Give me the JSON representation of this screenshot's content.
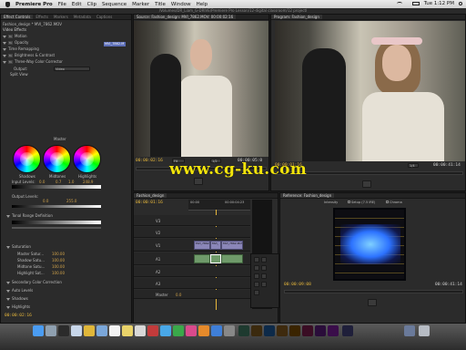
{
  "menubar": {
    "app": "Premiere Pro",
    "menus": [
      "File",
      "Edit",
      "Clip",
      "Sequence",
      "Marker",
      "Title",
      "Window",
      "Help"
    ],
    "clock": "Tue 1:12 PM"
  },
  "window_title": "/Volumes/DR_Liam_G-DRIVE/Premiere Pro Lesson/12-digital classroom/12 projectl",
  "effect_controls": {
    "tabs": [
      "Effect Controls",
      "Effects",
      "Markers",
      "Metadata",
      "Captions"
    ],
    "clip_path": "Fashion_design * MVI_7862.MOV",
    "clip_chip": "MVI_7862.M",
    "section": "Video Effects",
    "rows": [
      "Motion",
      "Opacity",
      "Time Remapping",
      "Brightness & Contrast",
      "Three-Way Color Corrector"
    ],
    "output_label": "Output:",
    "output_value": "Video",
    "split_view": "Split View",
    "master": "Master",
    "wheels": [
      "Shadows",
      "Midtones",
      "Highlights"
    ],
    "input_levels_label": "Input Levels:",
    "input_levels": [
      "0.0",
      "0.7",
      "1.0",
      "248.9"
    ],
    "output_levels_label": "Output Levels:",
    "output_levels": [
      "0.0",
      "255.0"
    ],
    "tonal_range": "Tonal Range Definition",
    "saturation": "Saturation",
    "sat_rows": [
      {
        "label": "Master Satur...",
        "value": "100.00"
      },
      {
        "label": "Shadow Satu...",
        "value": "100.00"
      },
      {
        "label": "Midtone Satu...",
        "value": "100.00"
      },
      {
        "label": "Highlight Sat...",
        "value": "100.00"
      }
    ],
    "secondary": "Secondary Color Correction",
    "auto_levels": "Auto Levels",
    "shadows": "Shadows",
    "highlights": "Highlights",
    "timecode": "00:00:02:16"
  },
  "source_monitor": {
    "tab": "Source: Fashion_design: MVI_7862.MOV: 00:00:02:16",
    "timecode_left": "00:00:02:16",
    "fit": "Fit",
    "zoom": "1/2",
    "timecode_right": "00:00:05:0"
  },
  "program_monitor": {
    "tab": "Program: Fashion_design",
    "timecode_left": "00:00:01:16",
    "zoom": "1/4",
    "timecode_right": "00:00:41:14"
  },
  "timeline": {
    "tab": "Fashion_design",
    "timecode": "00:00:01:16",
    "ruler": [
      "00:00",
      "00:00:04:23"
    ],
    "tracks": [
      "V3",
      "V2",
      "V1",
      "A1",
      "A2",
      "A3",
      "Master"
    ],
    "clip_labels": [
      "MVI_7862.MOV",
      "MVI_",
      "MVI_7862.MOV"
    ],
    "master_value": "0.0"
  },
  "reference_monitor": {
    "tab": "Reference: Fashion_design",
    "scope_label": "Intensity",
    "setup_label": "Setup (7.5 IRE)",
    "chroma_label": "Chroma",
    "timecode_left": "00:00:09:08",
    "timecode_right": "00:00:41:14"
  },
  "watermark": "www.cg-ku.com",
  "colors": {
    "timecode": "#e8b83c",
    "accent": "#d2a34a",
    "clip": "#8a86b8",
    "audio_clip": "#6f9a6a",
    "watermark": "#f2e40c"
  }
}
